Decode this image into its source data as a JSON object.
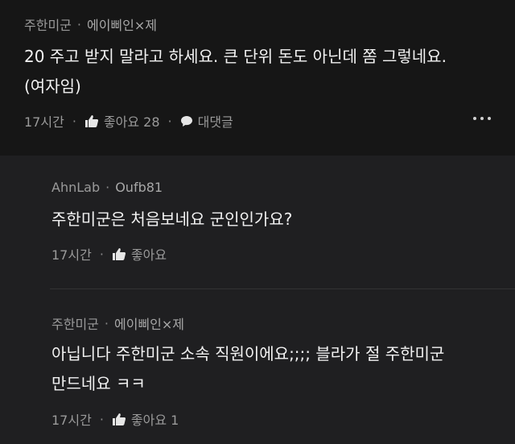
{
  "post": {
    "author": "주한미군",
    "company": "에이삐인×제",
    "text_line1": "20 주고 받지 말라고 하세요. 큰 단위 돈도 아닌데 쫌 그렇네요.",
    "text_line2": "(여자임)",
    "time": "17시간",
    "like_label": "좋아요 28",
    "reply_label": "대댓글"
  },
  "replies": [
    {
      "author": "AhnLab",
      "company": "Oufb81",
      "text_line1": "주한미군은 처음보네요 군인인가요?",
      "time": "17시간",
      "like_label": "좋아요"
    },
    {
      "author": "주한미군",
      "company": "에이삐인×제",
      "text_line1": "아닙니다 주한미군 소속 직원이에요;;;; 블라가 절 주한미군",
      "text_line2": "만드네요 ㅋㅋ",
      "time": "17시간",
      "like_label": "좋아요 1"
    }
  ],
  "icons": {
    "like": "thumbs-up-icon",
    "reply": "speech-bubble-icon",
    "more": "more-dots-icon"
  }
}
